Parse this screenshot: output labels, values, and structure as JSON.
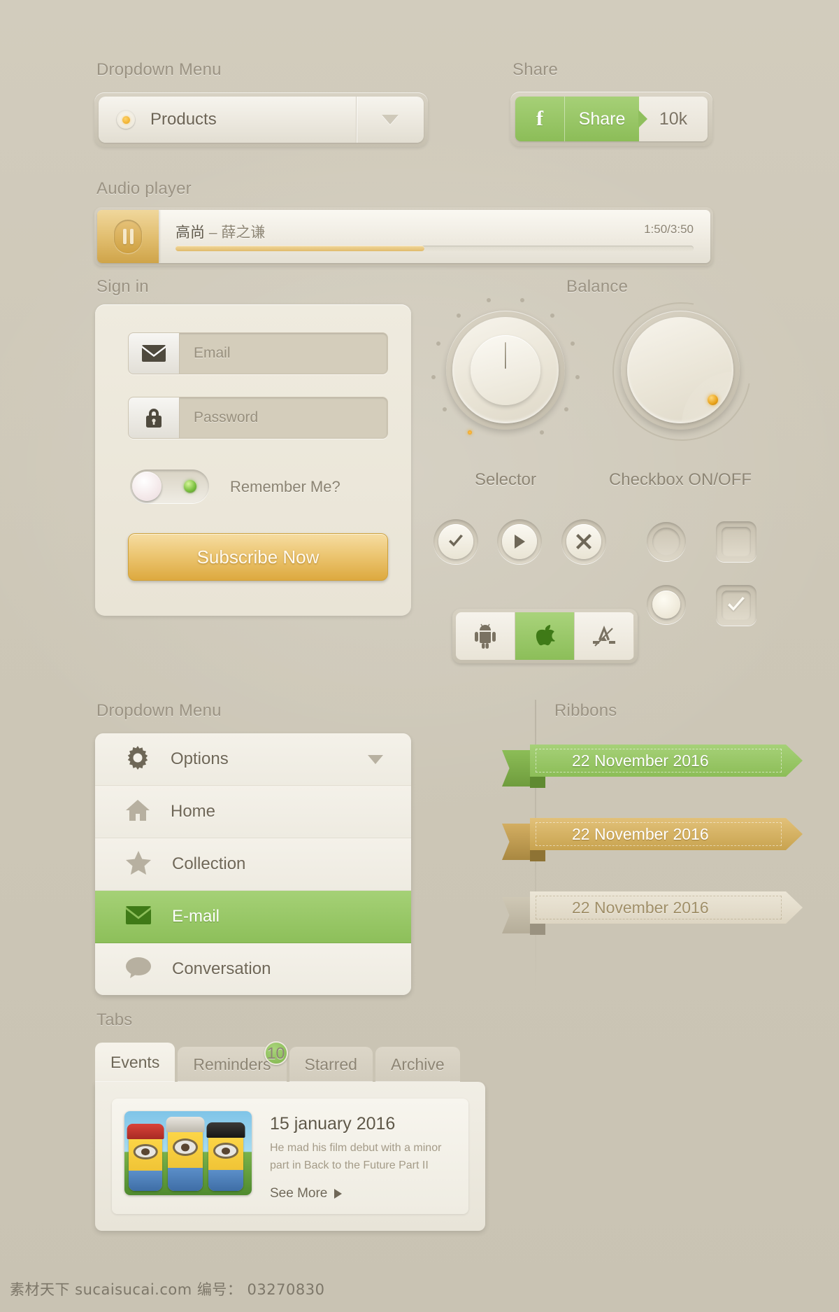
{
  "sections": {
    "dropdown_top": "Dropdown Menu",
    "share": "Share",
    "audio_player": "Audio player",
    "sign_in": "Sign in",
    "balance": "Balance",
    "dropdown_menu": "Dropdown Menu",
    "ribbons": "Ribbons",
    "tabs": "Tabs"
  },
  "dropdown_top": {
    "selected": "Products",
    "radio_icon": "radio-dot-icon",
    "caret_icon": "chevron-down-icon"
  },
  "share_widget": {
    "brand_glyph": "f",
    "brand_icon": "facebook-icon",
    "action_label": "Share",
    "count": "10k",
    "green": "#8cbd58"
  },
  "audio": {
    "play_icon": "pause-icon",
    "title": "高尚",
    "separator": "–",
    "artist": "薛之谦",
    "time": "1:50/3:50",
    "progress_percent": 48,
    "accent": "#e0bb6c"
  },
  "sign_in": {
    "email": {
      "icon": "envelope-icon",
      "placeholder": "Email",
      "value": ""
    },
    "password": {
      "icon": "lock-icon",
      "placeholder": "Password",
      "value": ""
    },
    "remember_label": "Remember Me?",
    "remember_on": false,
    "submit_label": "Subscribe Now",
    "submit_color": "#ecc673"
  },
  "balance": {
    "knobs": [
      {
        "name": "Selector",
        "type": "pointer-knob",
        "ticks": 12,
        "active_tick": 0
      },
      {
        "name": "Checkbox ON/OFF",
        "type": "indicator-knob",
        "led_color": "#e8a21a"
      }
    ],
    "round_buttons": [
      {
        "name": "check-button",
        "icon": "check-icon"
      },
      {
        "name": "play-button",
        "icon": "play-icon"
      },
      {
        "name": "close-button",
        "icon": "x-icon"
      }
    ],
    "selection_controls": [
      {
        "name": "radio-off",
        "shape": "circle",
        "checked": false
      },
      {
        "name": "checkbox-off",
        "shape": "square",
        "checked": false
      },
      {
        "name": "radio-on",
        "shape": "circle",
        "checked": true
      },
      {
        "name": "checkbox-on",
        "shape": "square",
        "checked": true
      }
    ],
    "os_segments": [
      {
        "name": "android",
        "icon": "android-icon",
        "active": false
      },
      {
        "name": "apple",
        "icon": "apple-icon",
        "active": true
      },
      {
        "name": "appstore",
        "icon": "appstore-icon",
        "active": false
      }
    ]
  },
  "menu": {
    "items": [
      {
        "label": "Options",
        "icon": "gear-icon",
        "active": false,
        "has_caret": true
      },
      {
        "label": "Home",
        "icon": "home-icon",
        "active": false,
        "has_caret": false
      },
      {
        "label": "Collection",
        "icon": "star-icon",
        "active": false,
        "has_caret": false
      },
      {
        "label": "E-mail",
        "icon": "envelope-icon",
        "active": true,
        "has_caret": false
      },
      {
        "label": "Conversation",
        "icon": "chat-icon",
        "active": false,
        "has_caret": false
      }
    ],
    "active_color": "#8dbf5a"
  },
  "ribbons": [
    {
      "text": "22 November 2016",
      "color": "#8cbd57",
      "variant": "green"
    },
    {
      "text": "22 November 2016",
      "color": "#c8a34f",
      "variant": "gold"
    },
    {
      "text": "22 November 2016",
      "color": "#ddd5c2",
      "variant": "cream"
    }
  ],
  "tabs": {
    "items": [
      {
        "label": "Events",
        "active": true,
        "badge": null
      },
      {
        "label": "Reminders",
        "active": false,
        "badge": "10"
      },
      {
        "label": "Starred",
        "active": false,
        "badge": null
      },
      {
        "label": "Archive",
        "active": false,
        "badge": null
      }
    ],
    "panel": {
      "thumbnail_alt": "minions-photo",
      "date": "15 january 2016",
      "description": "He mad his film debut with a minor part in Back to the Future Part II",
      "link_label": "See More",
      "link_icon": "chevron-right-icon"
    }
  },
  "watermark": "素材天下 sucaisucai.com  编号： 03270830"
}
